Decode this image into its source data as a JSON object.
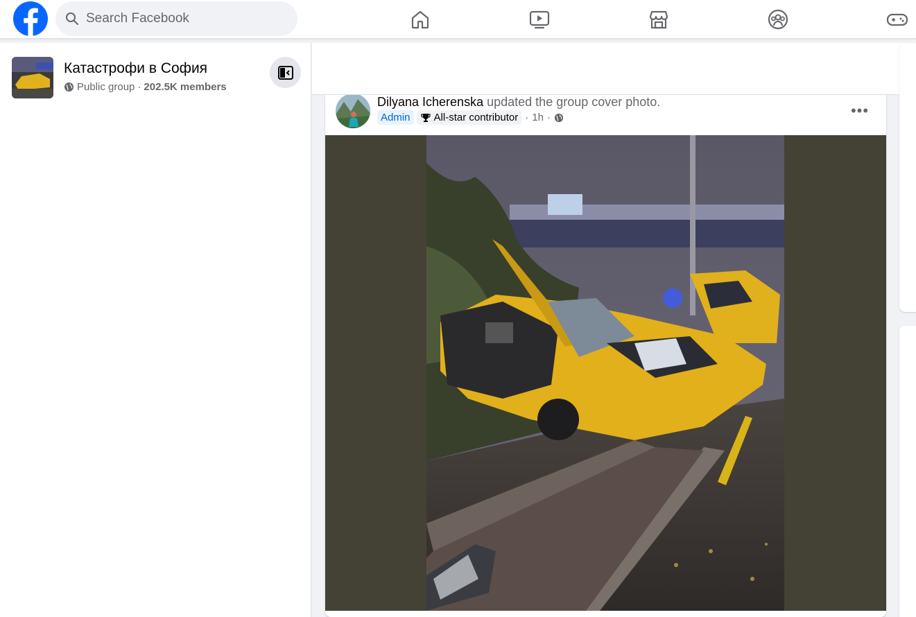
{
  "topbar": {
    "logo": "facebook-logo",
    "search_placeholder": "Search Facebook",
    "nav_tabs": [
      "home-icon",
      "watch-icon",
      "marketplace-icon",
      "groups-icon",
      "gaming-icon"
    ]
  },
  "sidebar": {
    "group_name": "Катастрофи в София",
    "privacy": "Public group",
    "separator": "·",
    "members": "202.5K members"
  },
  "post": {
    "author": "Dilyana Icherenska",
    "action": "updated the group cover photo.",
    "badges": [
      "Admin",
      "All-star contributor"
    ],
    "time": "1h",
    "separator": "·",
    "audience_icon": "globe-icon",
    "more_label": "•••"
  },
  "colors": {
    "brand": "#0866ff",
    "background": "#f0f2f5",
    "text_secondary": "#65676b",
    "admin_badge_text": "#0064d1",
    "photo_letterbox": "#434235"
  }
}
